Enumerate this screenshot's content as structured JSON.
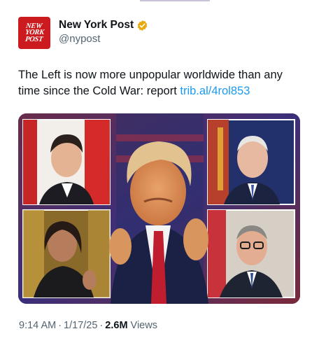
{
  "account": {
    "display_name": "New York Post",
    "handle": "@nypost",
    "logo_lines": [
      "NEW",
      "YORK",
      "POST"
    ],
    "verified_color": "#e9a80c"
  },
  "tweet": {
    "text": "The Left is now more unpopular worldwide than any time since the Cold War: report ",
    "link_text": "trib.al/4rol853",
    "link_color": "#1d9bf0"
  },
  "meta": {
    "time": "9:14 AM",
    "date": "1/17/25",
    "views_count": "2.6M",
    "views_label": "Views"
  },
  "media": {
    "panels": [
      "top-left-portrait",
      "top-right-portrait",
      "bottom-left-portrait",
      "bottom-right-portrait",
      "center-portrait"
    ]
  }
}
